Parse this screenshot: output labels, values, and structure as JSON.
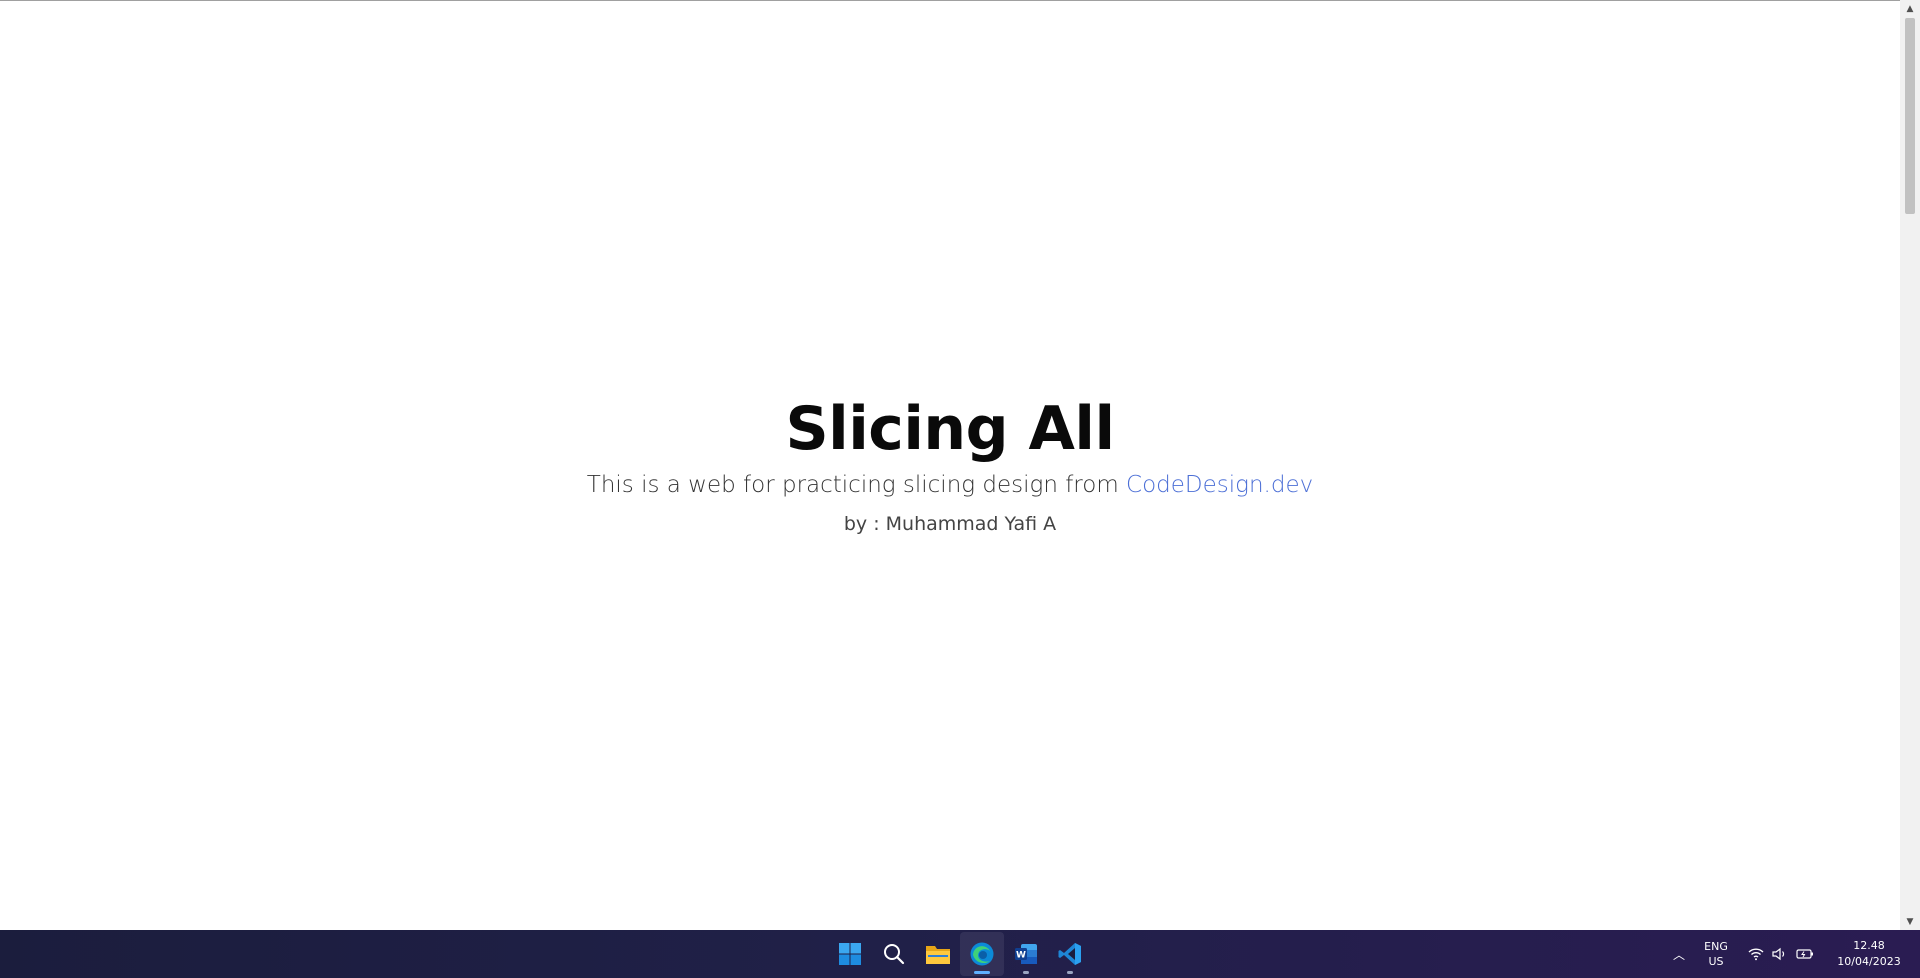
{
  "hero": {
    "title": "Slicing All",
    "subtitle_prefix": "This is a web for practicing slicing design from ",
    "link_text": "CodeDesign.dev",
    "author": "by : Muhammad Yafi A"
  },
  "taskbar": {
    "apps": [
      {
        "name": "start",
        "icon": "windows-start-icon"
      },
      {
        "name": "search",
        "icon": "search-icon"
      },
      {
        "name": "file-explorer",
        "icon": "folder-icon"
      },
      {
        "name": "edge",
        "icon": "edge-browser-icon",
        "active": true
      },
      {
        "name": "word",
        "icon": "word-icon"
      },
      {
        "name": "vscode",
        "icon": "vscode-icon"
      }
    ],
    "tray": {
      "language_line1": "ENG",
      "language_line2": "US",
      "time": "12.48",
      "date": "10/04/2023"
    }
  },
  "colors": {
    "link": "#4c6fd6",
    "title": "#0a0a0a",
    "taskbar_start": "#1b1d3d",
    "taskbar_end": "#2a1c52"
  }
}
